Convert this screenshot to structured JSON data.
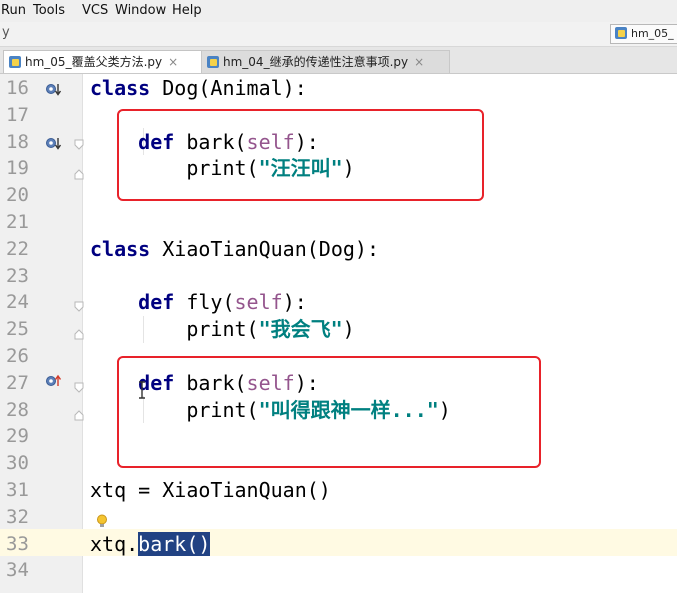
{
  "menubar": {
    "items": [
      "Run",
      "Tools",
      "VCS",
      "Window",
      "Help"
    ]
  },
  "navbar": {
    "chevron": "y",
    "tab_label": "hm_05_"
  },
  "tabs": [
    {
      "label": "hm_05_覆盖父类方法.py",
      "active": true,
      "close": "×"
    },
    {
      "label": "hm_04_继承的传递性注意事项.py",
      "active": false,
      "close": "×"
    }
  ],
  "editor": {
    "lines": [
      {
        "num": "16",
        "tokens": [
          [
            "class",
            "kw"
          ],
          [
            " Dog(Animal):",
            ""
          ]
        ]
      },
      {
        "num": "17",
        "tokens": []
      },
      {
        "num": "18",
        "tokens": [
          [
            "    ",
            ""
          ],
          [
            "def",
            "kw"
          ],
          [
            " bark(",
            ""
          ],
          [
            "self",
            "self"
          ],
          [
            "):",
            ""
          ]
        ]
      },
      {
        "num": "19",
        "tokens": [
          [
            "        print(",
            ""
          ],
          [
            "\"汪汪叫\"",
            "str"
          ],
          [
            ")",
            ""
          ]
        ]
      },
      {
        "num": "20",
        "tokens": []
      },
      {
        "num": "21",
        "tokens": []
      },
      {
        "num": "22",
        "tokens": [
          [
            "class",
            "kw"
          ],
          [
            " XiaoTianQuan(Dog):",
            ""
          ]
        ]
      },
      {
        "num": "23",
        "tokens": []
      },
      {
        "num": "24",
        "tokens": [
          [
            "    ",
            ""
          ],
          [
            "def",
            "kw"
          ],
          [
            " fly(",
            ""
          ],
          [
            "self",
            "self"
          ],
          [
            "):",
            ""
          ]
        ]
      },
      {
        "num": "25",
        "tokens": [
          [
            "        print(",
            ""
          ],
          [
            "\"我会飞\"",
            "str"
          ],
          [
            ")",
            ""
          ]
        ]
      },
      {
        "num": "26",
        "tokens": []
      },
      {
        "num": "27",
        "tokens": [
          [
            "    ",
            ""
          ],
          [
            "def",
            "kw"
          ],
          [
            " bark(",
            ""
          ],
          [
            "self",
            "self"
          ],
          [
            "):",
            ""
          ]
        ]
      },
      {
        "num": "28",
        "tokens": [
          [
            "        print(",
            ""
          ],
          [
            "\"叫得跟神一样...\"",
            "str"
          ],
          [
            ")",
            ""
          ]
        ]
      },
      {
        "num": "29",
        "tokens": []
      },
      {
        "num": "30",
        "tokens": []
      },
      {
        "num": "31",
        "tokens": [
          [
            "xtq = XiaoTianQuan()",
            ""
          ]
        ]
      },
      {
        "num": "32",
        "tokens": []
      },
      {
        "num": "33",
        "tokens": [
          [
            "xtq.",
            ""
          ],
          [
            "bark()",
            "sel"
          ]
        ]
      },
      {
        "num": "34",
        "tokens": []
      }
    ]
  },
  "icons": {
    "override_down": "overriding-method-icon",
    "override_up": "overrides-method-icon",
    "bulb": "intention-bulb-icon",
    "python_file": "python-file-icon"
  },
  "colors": {
    "highlight_box": "#e8222a",
    "current_line": "#fffae3",
    "selection": "#214283"
  }
}
